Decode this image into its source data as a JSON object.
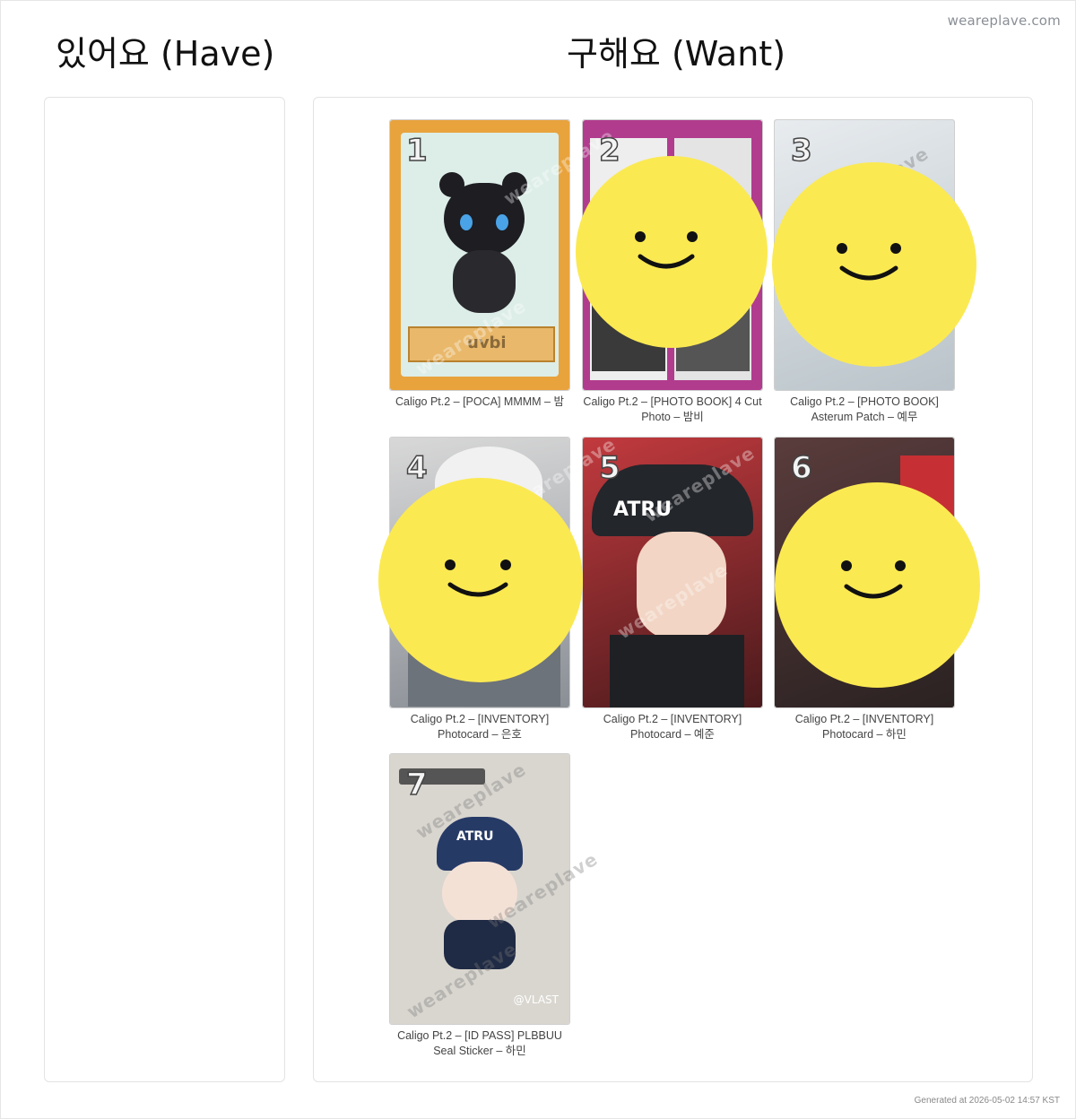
{
  "brand": "weareplave.com",
  "have": {
    "title": "있어요 (Have)"
  },
  "want": {
    "title": "구해요 (Want)",
    "items": [
      {
        "num": "1",
        "caption": "Caligo Pt.2 – [POCA] MMMM – 밤"
      },
      {
        "num": "2",
        "caption": "Caligo Pt.2 – [PHOTO BOOK] 4 Cut Photo – 밤비"
      },
      {
        "num": "3",
        "caption": "Caligo Pt.2 – [PHOTO BOOK] Asterum Patch – 예무"
      },
      {
        "num": "4",
        "caption": "Caligo Pt.2 – [INVENTORY] Photocard – 은호"
      },
      {
        "num": "5",
        "caption": "Caligo Pt.2 – [INVENTORY] Photocard – 예준"
      },
      {
        "num": "6",
        "caption": "Caligo Pt.2 – [INVENTORY] Photocard – 하민"
      },
      {
        "num": "7",
        "caption": "Caligo Pt.2 – [ID PASS] PLBBUU Seal Sticker – 하민"
      }
    ]
  },
  "watermark": "weareplave",
  "card_art": {
    "item1": {
      "hat_text": "",
      "badge": "uvbi"
    },
    "item5": {
      "hat_text": "ATRU"
    },
    "item7": {
      "hat_text": "ATRU",
      "corner": "@VLAST"
    }
  },
  "footer": "Generated at 2026-05-02 14:57 KST",
  "colors": {
    "smiley": "#fbe952",
    "card1_frame": "#e6a23c"
  }
}
